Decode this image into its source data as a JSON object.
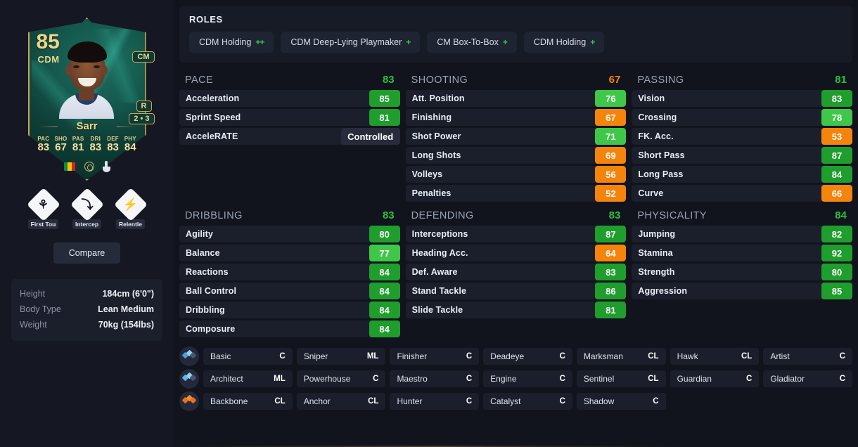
{
  "player_card": {
    "rating": "85",
    "position": "CDM",
    "alt_position": "CM",
    "foot": "R",
    "skill_weak": "2 • 3",
    "name": "Sarr",
    "stats": [
      {
        "label": "PAC",
        "value": "83"
      },
      {
        "label": "SHO",
        "value": "67"
      },
      {
        "label": "PAS",
        "value": "81"
      },
      {
        "label": "DRI",
        "value": "83"
      },
      {
        "label": "DEF",
        "value": "83"
      },
      {
        "label": "PHY",
        "value": "84"
      }
    ]
  },
  "playstyles": [
    {
      "name": "First Tou",
      "icon": "first-touch-icon",
      "glyph": "⚘"
    },
    {
      "name": "Intercep",
      "icon": "intercept-icon",
      "glyph": "⤵"
    },
    {
      "name": "Relentle",
      "icon": "relentless-icon",
      "glyph": "⚡"
    }
  ],
  "compare": {
    "label": "Compare"
  },
  "info": {
    "rows": [
      {
        "key": "Height",
        "value": "184cm (6'0\")"
      },
      {
        "key": "Body Type",
        "value": "Lean Medium"
      },
      {
        "key": "Weight",
        "value": "70kg (154lbs)"
      }
    ]
  },
  "roles": {
    "title": "ROLES",
    "items": [
      {
        "label": "CDM Holding",
        "plus": "++"
      },
      {
        "label": "CDM Deep-Lying Playmaker",
        "plus": "+"
      },
      {
        "label": "CM Box-To-Box",
        "plus": "+"
      },
      {
        "label": "CDM Holding",
        "plus": "+"
      }
    ]
  },
  "colors": {
    "green_dark": "#1f9e2d",
    "green_light": "#3fc74a",
    "orange": "#f5840c",
    "panel": "#1b1f2b",
    "background": "#11141c",
    "sidebar": "#151822"
  },
  "stat_groups": [
    {
      "name": "PACE",
      "value": "83",
      "value_color": "green",
      "stats": [
        {
          "name": "Acceleration",
          "value": "85",
          "color": "green-dark"
        },
        {
          "name": "Sprint Speed",
          "value": "81",
          "color": "green-dark"
        },
        {
          "name": "AcceleRATE",
          "value": "Controlled",
          "color": "plain"
        }
      ]
    },
    {
      "name": "SHOOTING",
      "value": "67",
      "value_color": "orange",
      "stats": [
        {
          "name": "Att. Position",
          "value": "76",
          "color": "green-light"
        },
        {
          "name": "Finishing",
          "value": "67",
          "color": "orange"
        },
        {
          "name": "Shot Power",
          "value": "71",
          "color": "green-light"
        },
        {
          "name": "Long Shots",
          "value": "69",
          "color": "orange"
        },
        {
          "name": "Volleys",
          "value": "56",
          "color": "orange"
        },
        {
          "name": "Penalties",
          "value": "52",
          "color": "orange"
        }
      ]
    },
    {
      "name": "PASSING",
      "value": "81",
      "value_color": "green",
      "stats": [
        {
          "name": "Vision",
          "value": "83",
          "color": "green-dark"
        },
        {
          "name": "Crossing",
          "value": "78",
          "color": "green-light"
        },
        {
          "name": "FK. Acc.",
          "value": "53",
          "color": "orange"
        },
        {
          "name": "Short Pass",
          "value": "87",
          "color": "green-dark"
        },
        {
          "name": "Long Pass",
          "value": "84",
          "color": "green-dark"
        },
        {
          "name": "Curve",
          "value": "66",
          "color": "orange"
        }
      ]
    },
    {
      "name": "DRIBBLING",
      "value": "83",
      "value_color": "green",
      "stats": [
        {
          "name": "Agility",
          "value": "80",
          "color": "green-dark"
        },
        {
          "name": "Balance",
          "value": "77",
          "color": "green-light"
        },
        {
          "name": "Reactions",
          "value": "84",
          "color": "green-dark"
        },
        {
          "name": "Ball Control",
          "value": "84",
          "color": "green-dark"
        },
        {
          "name": "Dribbling",
          "value": "84",
          "color": "green-dark"
        },
        {
          "name": "Composure",
          "value": "84",
          "color": "green-dark"
        }
      ]
    },
    {
      "name": "DEFENDING",
      "value": "83",
      "value_color": "green",
      "stats": [
        {
          "name": "Interceptions",
          "value": "87",
          "color": "green-dark"
        },
        {
          "name": "Heading Acc.",
          "value": "64",
          "color": "orange"
        },
        {
          "name": "Def. Aware",
          "value": "83",
          "color": "green-dark"
        },
        {
          "name": "Stand Tackle",
          "value": "86",
          "color": "green-dark"
        },
        {
          "name": "Slide Tackle",
          "value": "81",
          "color": "green-dark"
        }
      ]
    },
    {
      "name": "PHYSICALITY",
      "value": "84",
      "value_color": "green",
      "stats": [
        {
          "name": "Jumping",
          "value": "82",
          "color": "green-dark"
        },
        {
          "name": "Stamina",
          "value": "92",
          "color": "green-dark"
        },
        {
          "name": "Strength",
          "value": "80",
          "color": "green-dark"
        },
        {
          "name": "Aggression",
          "value": "85",
          "color": "green-dark"
        }
      ]
    }
  ],
  "chemistry_styles": {
    "rows": [
      {
        "icon": "chem-diamond-blue-icon",
        "cells": [
          {
            "name": "Basic",
            "tag": "C"
          },
          {
            "name": "Sniper",
            "tag": "ML"
          },
          {
            "name": "Finisher",
            "tag": "C"
          },
          {
            "name": "Deadeye",
            "tag": "C"
          },
          {
            "name": "Marksman",
            "tag": "CL"
          },
          {
            "name": "Hawk",
            "tag": "CL"
          },
          {
            "name": "Artist",
            "tag": "C"
          }
        ]
      },
      {
        "icon": "chem-diamond-blue2-icon",
        "cells": [
          {
            "name": "Architect",
            "tag": "ML"
          },
          {
            "name": "Powerhouse",
            "tag": "C"
          },
          {
            "name": "Maestro",
            "tag": "C"
          },
          {
            "name": "Engine",
            "tag": "C"
          },
          {
            "name": "Sentinel",
            "tag": "CL"
          },
          {
            "name": "Guardian",
            "tag": "C"
          },
          {
            "name": "Gladiator",
            "tag": "C"
          }
        ]
      },
      {
        "icon": "chem-diamond-orange-icon",
        "cells": [
          {
            "name": "Backbone",
            "tag": "CL"
          },
          {
            "name": "Anchor",
            "tag": "CL"
          },
          {
            "name": "Hunter",
            "tag": "C"
          },
          {
            "name": "Catalyst",
            "tag": "C"
          },
          {
            "name": "Shadow",
            "tag": "C"
          },
          {
            "name": "",
            "tag": ""
          },
          {
            "name": "",
            "tag": ""
          }
        ]
      }
    ]
  }
}
